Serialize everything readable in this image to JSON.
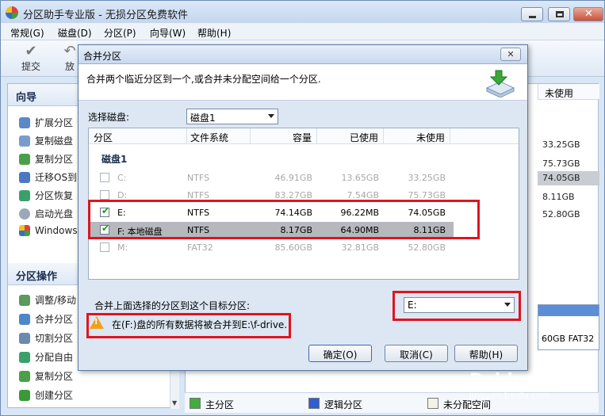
{
  "app": {
    "title": "分区助手专业版 - 无损分区免费软件",
    "menu": [
      "常规(G)",
      "磁盘(D)",
      "分区(P)",
      "向导(W)",
      "帮助(H)"
    ],
    "toolbar": [
      {
        "label": "提交",
        "icon": "check-icon"
      },
      {
        "label": "放",
        "icon": "undo-icon"
      }
    ]
  },
  "left_panel": {
    "wizard_title": "向导",
    "wizard_items": [
      "扩展分区",
      "复制磁盘",
      "复制分区",
      "迁移OS到",
      "分区恢复",
      "启动光盘",
      "Windows T"
    ],
    "ops_title": "分区操作",
    "ops_items": [
      "调整/移动",
      "合并分区",
      "切割分区",
      "分配自由",
      "复制分区",
      "创建分区"
    ]
  },
  "right_panel": {
    "col_header": "未使用",
    "values": [
      "33.25GB",
      "75.73GB",
      "74.05GB",
      "8.11GB",
      "52.80GB"
    ],
    "selected_index": 2,
    "diskbar_text": "60GB FAT32",
    "legend": [
      {
        "label": "主分区",
        "color": "#3fae3f"
      },
      {
        "label": "逻辑分区",
        "color": "#2f5fd0"
      },
      {
        "label": "未分配空间",
        "color": "#f2f2e6"
      }
    ]
  },
  "dialog": {
    "title": "合并分区",
    "close_label": "✕",
    "description": "合并两个临近分区到一个,或合并未分配空间给一个分区.",
    "select_disk_label": "选择磁盘:",
    "select_disk_value": "磁盘1",
    "columns": [
      "分区",
      "文件系统",
      "容量",
      "已使用",
      "未使用"
    ],
    "group": "磁盘1",
    "rows": [
      {
        "name": "C:",
        "fs": "NTFS",
        "capacity": "46.91GB",
        "used": "13.65GB",
        "free": "33.25GB",
        "checked": false,
        "dim": true,
        "selected": false
      },
      {
        "name": "D:",
        "fs": "NTFS",
        "capacity": "83.27GB",
        "used": "7.54GB",
        "free": "75.73GB",
        "checked": false,
        "dim": true,
        "selected": false
      },
      {
        "name": "E:",
        "fs": "NTFS",
        "capacity": "74.14GB",
        "used": "96.22MB",
        "free": "74.05GB",
        "checked": true,
        "dim": false,
        "selected": false
      },
      {
        "name": "F:  本地磁盘",
        "fs": "NTFS",
        "capacity": "8.17GB",
        "used": "64.90MB",
        "free": "8.11GB",
        "checked": true,
        "dim": false,
        "selected": true
      },
      {
        "name": "M:",
        "fs": "FAT32",
        "capacity": "85.60GB",
        "used": "32.81GB",
        "free": "52.80GB",
        "checked": false,
        "dim": true,
        "selected": false
      }
    ],
    "target_label": "合并上面选择的分区到这个目标分区:",
    "target_value": "E:",
    "warning": "在(F:)盘的所有数据将被合并到E:\\f-drive.",
    "buttons": {
      "ok": "确定(O)",
      "cancel": "取消(C)",
      "help": "帮助(H)"
    }
  },
  "watermark": {
    "brand": "Baidu 经验",
    "url": "jingyan.baidu.com"
  }
}
